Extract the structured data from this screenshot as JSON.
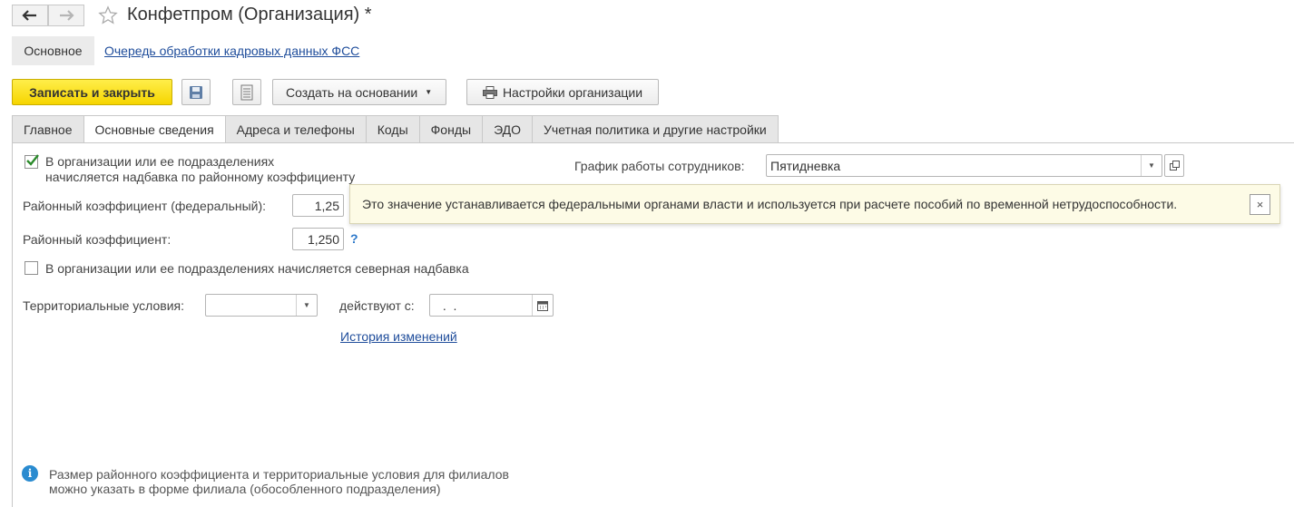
{
  "window": {
    "title": "Конфетпром (Организация) *"
  },
  "subnav": {
    "active_label": "Основное",
    "link_label": "Очередь обработки кадровых данных ФСС"
  },
  "toolbar": {
    "save_close_label": "Записать и закрыть",
    "create_based_label": "Создать на основании",
    "org_settings_label": "Настройки организации"
  },
  "tabs": [
    {
      "label": "Главное",
      "active": false
    },
    {
      "label": "Основные сведения",
      "active": true
    },
    {
      "label": "Адреса и телефоны",
      "active": false
    },
    {
      "label": "Коды",
      "active": false
    },
    {
      "label": "Фонды",
      "active": false
    },
    {
      "label": "ЭДО",
      "active": false
    },
    {
      "label": "Учетная политика и другие настройки",
      "active": false
    }
  ],
  "form": {
    "district_allowance": {
      "checked": true,
      "label_line1": "В организации или ее подразделениях",
      "label_line2": "начисляется надбавка по районному коэффициенту"
    },
    "work_schedule": {
      "label": "График работы сотрудников:",
      "value": "Пятидневка"
    },
    "federal_coeff": {
      "label": "Районный коэффициент (федеральный):",
      "value": "1,25"
    },
    "coeff": {
      "label": "Районный коэффициент:",
      "value": "1,250",
      "help": "?"
    },
    "northern_allowance": {
      "checked": false,
      "label": "В организации или ее подразделениях начисляется северная надбавка"
    },
    "territorial": {
      "label": "Территориальные условия:",
      "value": "",
      "effective_label": "действуют с:",
      "date_value": " .  ."
    },
    "history_link": "История изменений"
  },
  "tooltip": {
    "text": "Это значение устанавливается федеральными органами власти и используется при расчете пособий по временной нетрудоспособности.",
    "close": "×"
  },
  "footer_note": {
    "line1": "Размер районного коэффициента и территориальные условия для филиалов",
    "line2": "можно указать в форме филиала (обособленного подразделения)"
  },
  "icons": {
    "back": "arrow-left-icon",
    "forward": "arrow-right-icon",
    "favorite": "star-icon",
    "save": "floppy-icon",
    "report": "document-icon",
    "printer": "printer-icon",
    "info": "info-icon",
    "calendar": "calendar-icon"
  },
  "colors": {
    "primary_button": "#f6d500",
    "link": "#1f4d9b",
    "check": "#2a8a2a",
    "info": "#2a8bd0",
    "tooltip_bg": "#fdfbe6"
  }
}
